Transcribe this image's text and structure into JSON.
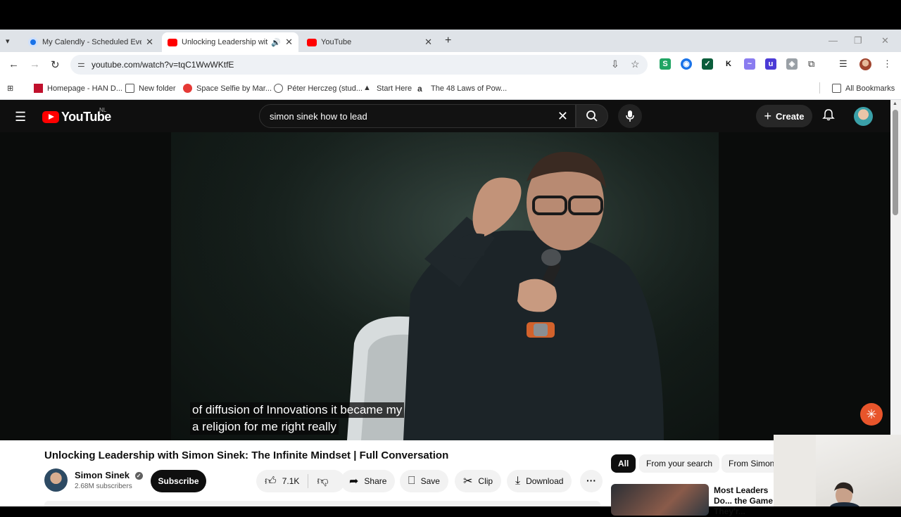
{
  "browser": {
    "tabs": [
      {
        "title": "My Calendly - Scheduled Events",
        "favicon_color": "#1a73e8"
      },
      {
        "title": "Unlocking Leadership with Simon Sinek",
        "favicon_color": "#ff0000",
        "audio": "🔊"
      },
      {
        "title": "YouTube",
        "favicon_color": "#ff0000"
      }
    ],
    "new_tab": "+",
    "url": "youtube.com/watch?v=tqC1WwWKtfE",
    "extensions": [
      {
        "label": "S",
        "color": "#1fa463"
      },
      {
        "label": "◉",
        "color": "#1a73e8"
      },
      {
        "label": "✓",
        "color": "#0b5d3b"
      },
      {
        "label": "K",
        "color": "#ffffff"
      },
      {
        "label": "~",
        "color": "#8a7cf0"
      },
      {
        "label": "u",
        "color": "#4b3bd6"
      },
      {
        "label": "◈",
        "color": "#9aa0a6"
      }
    ],
    "bookmarks": [
      {
        "label": "Homepage - HAN D...",
        "icon": "han-icon"
      },
      {
        "label": "New folder",
        "icon": "folder-icon"
      },
      {
        "label": "Space Selfie by Mar...",
        "icon": "space-icon"
      },
      {
        "label": "Péter Herczeg (stud...",
        "icon": "globe-icon"
      },
      {
        "label": "Start Here",
        "icon": "start-icon"
      },
      {
        "label": "The 48 Laws of Pow...",
        "icon": "amazon-icon"
      }
    ],
    "all_bookmarks": "All Bookmarks"
  },
  "youtube": {
    "logo_text": "YouTube",
    "country_code": "NL",
    "search_query": "simon sinek how to lead",
    "create_label": "Create",
    "captions": [
      "of diffusion of Innovations it became my",
      "a religion for me right really"
    ],
    "video_title": "Unlocking Leadership with Simon Sinek: The Infinite Mindset | Full Conversation",
    "channel_name": "Simon Sinek",
    "verified": "✓",
    "subscribers": "2.68M subscribers",
    "subscribe_label": "Subscribe",
    "likes": "7.1K",
    "share_label": "Share",
    "save_label": "Save",
    "clip_label": "Clip",
    "download_label": "Download",
    "chips": [
      "All",
      "From your search",
      "From Simon"
    ],
    "recommendation_title": "Most Leaders Do... the Game They'r..."
  }
}
